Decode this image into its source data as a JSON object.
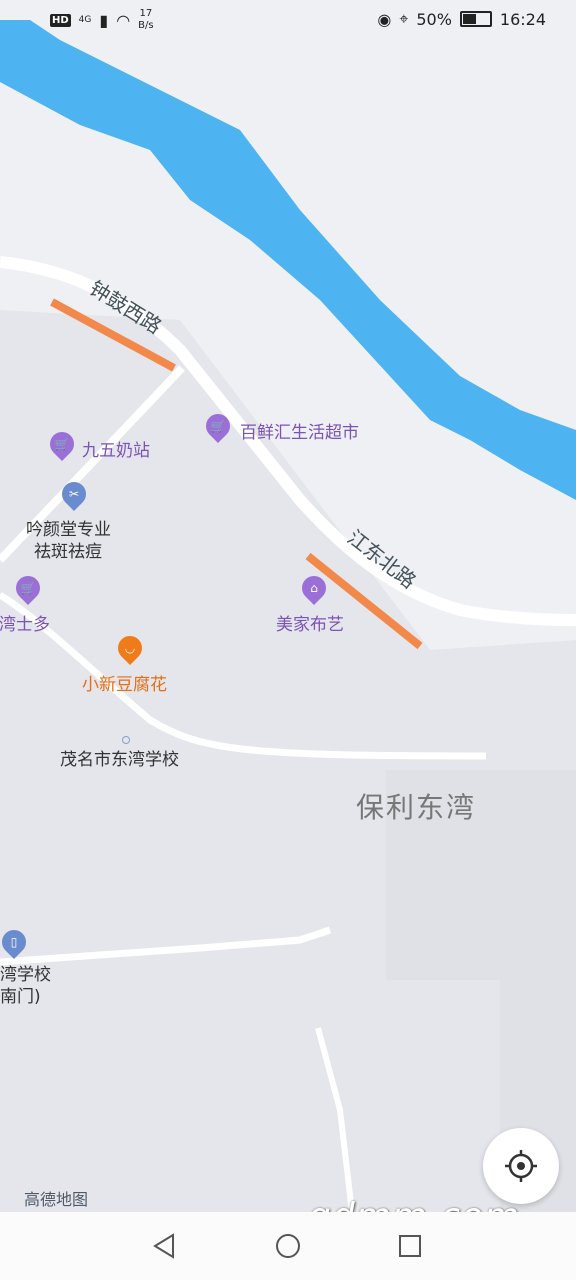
{
  "status_bar": {
    "hd": "HD",
    "network": "4G",
    "speed_value": "17",
    "speed_unit": "B/s",
    "battery": "50%",
    "time": "16:24"
  },
  "map": {
    "roads": {
      "zhonggu_west": "钟鼓西路",
      "jiangdong_north": "江东北路"
    },
    "area_label": "保利东湾",
    "pois": [
      {
        "name": "九五奶站",
        "icon": "shopping-cart-icon"
      },
      {
        "name": "百鲜汇生活超市",
        "icon": "shopping-cart-icon"
      },
      {
        "name_line1": "吟颜堂专业",
        "name_line2": "祛斑祛痘",
        "icon": "scissors-icon"
      },
      {
        "name": "港湾士多",
        "icon": "shopping-cart-icon"
      },
      {
        "name": "美家布艺",
        "icon": "store-icon"
      },
      {
        "name": "小新豆腐花",
        "icon": "bowl-icon"
      },
      {
        "name": "茂名市东湾学校"
      },
      {
        "name_line1": "湾学校",
        "name_line2": "南门)",
        "icon": "door-icon"
      }
    ],
    "brand": "高德地图",
    "watermark": "gdmm.com"
  },
  "nav_bar": {
    "back": "back-icon",
    "home": "home-icon",
    "recents": "recents-icon"
  },
  "colors": {
    "river": "#4db3f1",
    "poi_purple": "#7b52b5",
    "poi_orange": "#e86c13",
    "highlight_road": "#f2894a"
  }
}
